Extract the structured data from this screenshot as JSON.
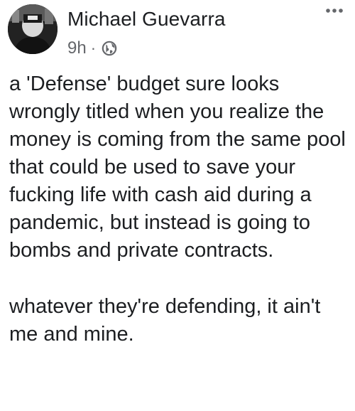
{
  "author": {
    "name": "Michael Guevarra",
    "timestamp": "9h",
    "separator": "·",
    "privacy_icon": "globe-icon"
  },
  "menu_icon": "more-horizontal-icon",
  "post": {
    "paragraphs": [
      "a 'Defense' budget sure looks wrongly titled when you realize the money is coming from the same pool that could be used to save your fucking life with cash aid during a pandemic, but instead is going to bombs and private contracts.",
      "whatever they're defending, it ain't me and mine."
    ]
  },
  "colors": {
    "text": "#1c1e21",
    "secondary_text": "#65676b",
    "background": "#ffffff"
  }
}
